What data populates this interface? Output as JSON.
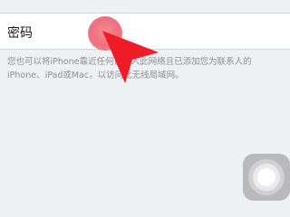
{
  "password": {
    "label": "密码",
    "value": ""
  },
  "help_text": "您也可以将iPhone靠近任何已接入此网络且已添加您为联系人的iPhone、iPad或Mac，以访问此无线局域网。",
  "overlays": {
    "touch_indicator_icon": "touch-point-icon",
    "pointer_icon": "arrow-pointer-icon",
    "assistive_touch_icon": "assistive-touch-icon",
    "pointer_color": "#ef1c27",
    "touch_color": "#ef6f7d"
  }
}
